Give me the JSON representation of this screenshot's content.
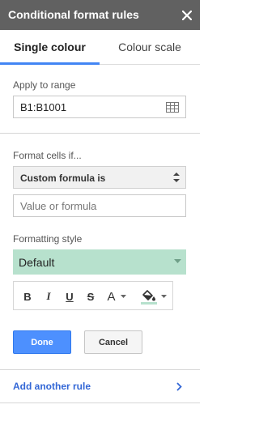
{
  "header": {
    "title": "Conditional format rules",
    "close_icon": "close-icon"
  },
  "tabs": [
    {
      "label": "Single colour",
      "active": true
    },
    {
      "label": "Colour scale",
      "active": false
    }
  ],
  "range": {
    "label": "Apply to range",
    "value": "B1:B1001",
    "icon": "grid-select-icon"
  },
  "condition": {
    "label": "Format cells if...",
    "selected": "Custom formula is",
    "input_placeholder": "Value or formula",
    "input_value": ""
  },
  "formatting": {
    "label": "Formatting style",
    "preset": "Default",
    "preset_color": "#b7e1cd",
    "toolbar": {
      "bold": "B",
      "italic": "I",
      "underline": "U",
      "strikethrough": "S",
      "text_color": "A",
      "fill_icon": "paint-bucket-icon"
    }
  },
  "actions": {
    "done": "Done",
    "cancel": "Cancel"
  },
  "add_rule": {
    "label": "Add another rule"
  },
  "colors": {
    "accent": "#4285f4",
    "header_bg": "#616161",
    "link": "#3367d6",
    "done_bg": "#4d90fe"
  }
}
